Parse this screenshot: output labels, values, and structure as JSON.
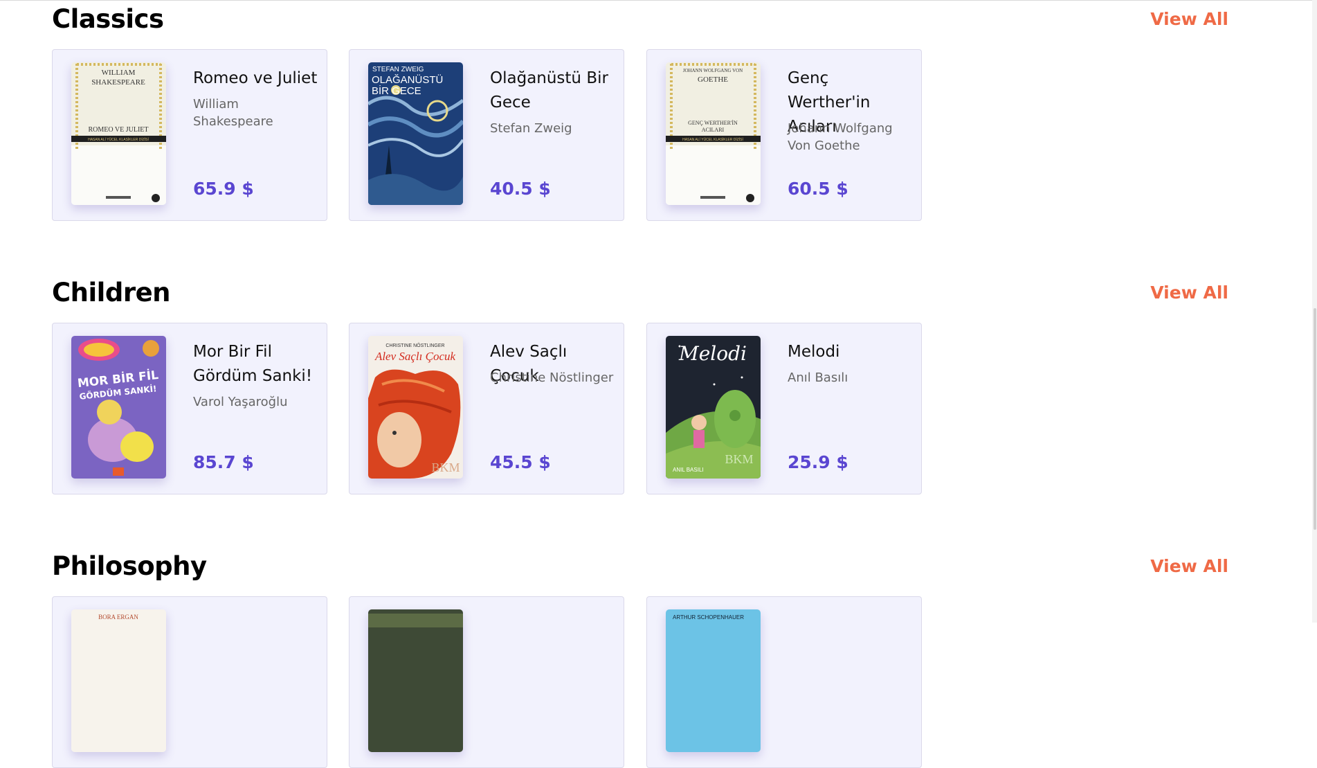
{
  "sections": [
    {
      "title": "Classics",
      "view_all": "View All",
      "books": [
        {
          "title": "Romeo ve Juliet",
          "author": "William Shakespeare",
          "price": "65.9 $",
          "cover": {
            "top_text": "WILLIAM SHAKESPEARE",
            "main_text": "ROMEO VE JULIET",
            "band_text": "HASAN ALİ YÜCEL KLASİKLER DİZİSİ"
          }
        },
        {
          "title": "Olağanüstü Bir Gece",
          "author": "Stefan Zweig",
          "price": "40.5 $",
          "cover": {
            "top_text": "STEFAN ZWEIG",
            "main_text": "OLAĞANÜSTÜ",
            "sub_text": "BİR GECE"
          }
        },
        {
          "title": "Genç Werther'in Acıları",
          "author": "Johann Wolfgang Von Goethe",
          "price": "60.5 $",
          "cover": {
            "top_text": "JOHANN WOLFGANG VON GOETHE",
            "main_text": "GENÇ WERTHER'İN ACILARI",
            "band_text": "HASAN ALİ YÜCEL KLASİKLER DİZİSİ"
          }
        }
      ]
    },
    {
      "title": "Children",
      "view_all": "View All",
      "books": [
        {
          "title": "Mor Bir Fil Gördüm Sanki!",
          "author": "Varol Yaşaroğlu",
          "price": "85.7 $",
          "cover": {
            "main_text": "MOR BİR FİL",
            "sub_text": "GÖRDÜM SANKİ!"
          }
        },
        {
          "title": "Alev Saçlı Çocuk",
          "author": "Christine Nöstlinger",
          "price": "45.5 $",
          "cover": {
            "top_text": "CHRISTINE NÖSTLINGER",
            "main_text": "Alev Saçlı Çocuk",
            "brand": "BKM"
          }
        },
        {
          "title": "Melodi",
          "author": "Anıl Basılı",
          "price": "25.9 $",
          "cover": {
            "main_text": "Melodi",
            "bottom_text": "ANIL BASILI",
            "brand": "BKM"
          }
        }
      ]
    },
    {
      "title": "Philosophy",
      "view_all": "View All",
      "books": [
        {
          "cover": {
            "top_text": "BORA ERGAN"
          }
        },
        {
          "cover": {}
        },
        {
          "cover": {
            "top_text": "ARTHUR SCHOPENHAUER"
          }
        }
      ]
    }
  ],
  "colors": {
    "accent": "#ef6a46",
    "price": "#5a46d1",
    "card_bg": "#f2f2fd"
  }
}
